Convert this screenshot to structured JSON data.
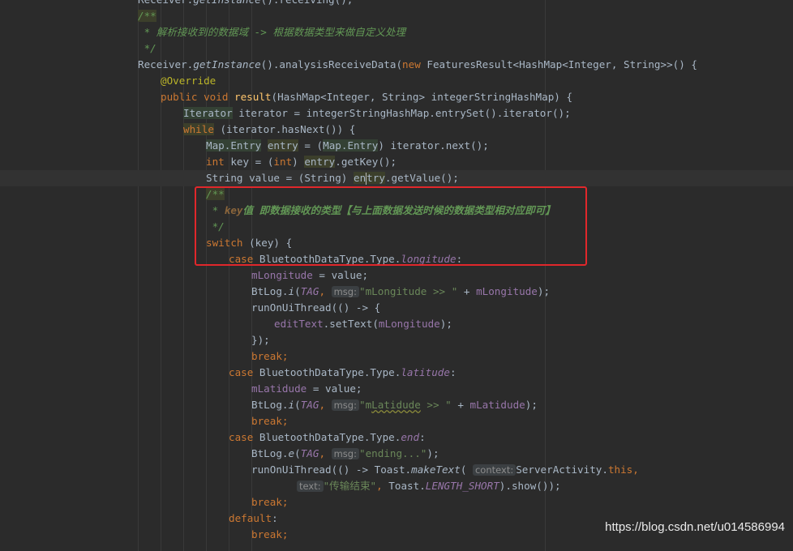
{
  "editor": {
    "lines": [
      {
        "indent": 0,
        "tokens": [
          {
            "t": "Receiver.",
            "c": ""
          },
          {
            "t": "getInstance",
            "c": "it"
          },
          {
            "t": "().receiving();",
            "c": ""
          }
        ]
      },
      {
        "indent": 0,
        "tokens": [
          {
            "t": "/**",
            "c": "cm hl"
          }
        ]
      },
      {
        "indent": 0,
        "tokens": [
          {
            "t": " * 解析接收到的数据域 -> 根据数据类型来做自定义处理",
            "c": "cm"
          }
        ]
      },
      {
        "indent": 0,
        "tokens": [
          {
            "t": " */",
            "c": "cm"
          }
        ]
      },
      {
        "indent": 0,
        "tokens": [
          {
            "t": "Receiver.",
            "c": ""
          },
          {
            "t": "getInstance",
            "c": "it"
          },
          {
            "t": "().analysisReceiveData(",
            "c": ""
          },
          {
            "t": "new ",
            "c": "kw"
          },
          {
            "t": "FeaturesResult<HashMap<Integer, String>>() {",
            "c": ""
          }
        ]
      },
      {
        "indent": 1,
        "tokens": [
          {
            "t": "@Override",
            "c": "an"
          }
        ]
      },
      {
        "indent": 1,
        "tokens": [
          {
            "t": "public void ",
            "c": "kw"
          },
          {
            "t": "result",
            "c": "fn"
          },
          {
            "t": "(HashMap<Integer, String> integerStringHashMap) {",
            "c": ""
          }
        ]
      },
      {
        "indent": 2,
        "tokens": [
          {
            "t": "Iterator",
            "c": "cls"
          },
          {
            "t": " iterator = integerStringHashMap.entrySet().iterator();",
            "c": ""
          }
        ]
      },
      {
        "indent": 2,
        "tokens": [
          {
            "t": "while",
            "c": "kw hl"
          },
          {
            "t": " (iterator.hasNext()) {",
            "c": ""
          }
        ]
      },
      {
        "indent": 3,
        "tokens": [
          {
            "t": "Map.Entry",
            "c": "cls"
          },
          {
            "t": " ",
            "c": ""
          },
          {
            "t": "entry",
            "c": "hl"
          },
          {
            "t": " = (",
            "c": ""
          },
          {
            "t": "Map.Entry",
            "c": "cls"
          },
          {
            "t": ") iterator.next();",
            "c": ""
          }
        ]
      },
      {
        "indent": 3,
        "tokens": [
          {
            "t": "int ",
            "c": "kw"
          },
          {
            "t": "key = (",
            "c": ""
          },
          {
            "t": "int",
            "c": "kw"
          },
          {
            "t": ") ",
            "c": ""
          },
          {
            "t": "entry",
            "c": "hl"
          },
          {
            "t": ".getKey();",
            "c": ""
          }
        ]
      },
      {
        "indent": 3,
        "current": true,
        "tokens": [
          {
            "t": "String value = (String) ",
            "c": ""
          },
          {
            "t": "en",
            "c": "hl"
          },
          {
            "caret": true
          },
          {
            "t": "try",
            "c": "hl"
          },
          {
            "t": ".getValue();",
            "c": ""
          }
        ]
      },
      {
        "indent": 3,
        "tokens": [
          {
            "t": "/**",
            "c": "cm hl"
          }
        ]
      },
      {
        "indent": 3,
        "tokens": [
          {
            "t": " * ",
            "c": "cm"
          },
          {
            "t": "key",
            "c": "cmt"
          },
          {
            "t": "值 即数据接收的类型【与上面数据发送时候的数据类型相对应即可】",
            "c": "cmb"
          }
        ]
      },
      {
        "indent": 3,
        "tokens": [
          {
            "t": " */",
            "c": "cm"
          }
        ]
      },
      {
        "indent": 3,
        "tokens": [
          {
            "t": "switch ",
            "c": "kw"
          },
          {
            "t": "(key) {",
            "c": ""
          }
        ]
      },
      {
        "indent": 4,
        "tokens": [
          {
            "t": "case ",
            "c": "kw"
          },
          {
            "t": "BluetoothDataType.Type.",
            "c": ""
          },
          {
            "t": "longitude",
            "c": "fd it"
          },
          {
            "t": ":",
            "c": ""
          }
        ]
      },
      {
        "indent": 5,
        "tokens": [
          {
            "t": "mLongitude",
            "c": "fd"
          },
          {
            "t": " = value;",
            "c": ""
          }
        ]
      },
      {
        "indent": 5,
        "tokens": [
          {
            "t": "BtLog.",
            "c": ""
          },
          {
            "t": "i",
            "c": "it"
          },
          {
            "t": "(",
            "c": ""
          },
          {
            "t": "TAG",
            "c": "tagc"
          },
          {
            "t": ", ",
            "c": "kw"
          },
          {
            "hint": "msg:"
          },
          {
            "t": "\"mLongitude >> \"",
            "c": "st"
          },
          {
            "t": " + ",
            "c": ""
          },
          {
            "t": "mLongitude",
            "c": "fd"
          },
          {
            "t": ");",
            "c": ""
          }
        ]
      },
      {
        "indent": 5,
        "tokens": [
          {
            "t": "runOnUiThread(() -> {",
            "c": ""
          }
        ]
      },
      {
        "indent": 6,
        "tokens": [
          {
            "t": "editText",
            "c": "fd"
          },
          {
            "t": ".setText(",
            "c": ""
          },
          {
            "t": "mLongitude",
            "c": "fd"
          },
          {
            "t": ");",
            "c": ""
          }
        ]
      },
      {
        "indent": 5,
        "tokens": [
          {
            "t": "});",
            "c": ""
          }
        ]
      },
      {
        "indent": 5,
        "tokens": [
          {
            "t": "break;",
            "c": "kw"
          }
        ]
      },
      {
        "indent": 4,
        "tokens": [
          {
            "t": "case ",
            "c": "kw"
          },
          {
            "t": "BluetoothDataType.Type.",
            "c": ""
          },
          {
            "t": "latitude",
            "c": "fd it"
          },
          {
            "t": ":",
            "c": ""
          }
        ]
      },
      {
        "indent": 5,
        "tokens": [
          {
            "t": "mLatidude",
            "c": "fd"
          },
          {
            "t": " = value;",
            "c": ""
          }
        ]
      },
      {
        "indent": 5,
        "tokens": [
          {
            "t": "BtLog.",
            "c": ""
          },
          {
            "t": "i",
            "c": "it"
          },
          {
            "t": "(",
            "c": ""
          },
          {
            "t": "TAG",
            "c": "tagc"
          },
          {
            "t": ", ",
            "c": "kw"
          },
          {
            "hint": "msg:"
          },
          {
            "t": "\"m",
            "c": "st"
          },
          {
            "t": "Latidude",
            "c": "st uw"
          },
          {
            "t": " >> \"",
            "c": "st"
          },
          {
            "t": " + ",
            "c": ""
          },
          {
            "t": "mLatidude",
            "c": "fd"
          },
          {
            "t": ");",
            "c": ""
          }
        ]
      },
      {
        "indent": 5,
        "tokens": [
          {
            "t": "break;",
            "c": "kw"
          }
        ]
      },
      {
        "indent": 4,
        "tokens": [
          {
            "t": "case ",
            "c": "kw"
          },
          {
            "t": "BluetoothDataType.Type.",
            "c": ""
          },
          {
            "t": "end",
            "c": "fd it"
          },
          {
            "t": ":",
            "c": ""
          }
        ]
      },
      {
        "indent": 5,
        "tokens": [
          {
            "t": "BtLog.",
            "c": ""
          },
          {
            "t": "e",
            "c": "it"
          },
          {
            "t": "(",
            "c": ""
          },
          {
            "t": "TAG",
            "c": "tagc"
          },
          {
            "t": ", ",
            "c": "kw"
          },
          {
            "hint": "msg:"
          },
          {
            "t": "\"ending...\"",
            "c": "st"
          },
          {
            "t": ");",
            "c": ""
          }
        ]
      },
      {
        "indent": 5,
        "tokens": [
          {
            "t": "runOnUiThread(() -> Toast.",
            "c": ""
          },
          {
            "t": "makeText",
            "c": "it"
          },
          {
            "t": "( ",
            "c": ""
          },
          {
            "hint": "context:"
          },
          {
            "t": "ServerActivity.",
            "c": ""
          },
          {
            "t": "this",
            "c": "kw"
          },
          {
            "t": ",",
            "c": "kw"
          }
        ]
      },
      {
        "indent": 7,
        "tokens": [
          {
            "hint": "text:"
          },
          {
            "t": "\"传输结束\"",
            "c": "st"
          },
          {
            "t": ", ",
            "c": "kw"
          },
          {
            "t": "Toast.",
            "c": ""
          },
          {
            "t": "LENGTH_SHORT",
            "c": "fd it"
          },
          {
            "t": ").show());",
            "c": ""
          }
        ]
      },
      {
        "indent": 5,
        "tokens": [
          {
            "t": "break;",
            "c": "kw"
          }
        ]
      },
      {
        "indent": 4,
        "tokens": [
          {
            "t": "default",
            "c": "kw"
          },
          {
            "t": ":",
            "c": ""
          }
        ]
      },
      {
        "indent": 5,
        "tokens": [
          {
            "t": "break;",
            "c": "kw"
          }
        ]
      }
    ]
  },
  "watermark": "https://blog.csdn.net/u014586994"
}
